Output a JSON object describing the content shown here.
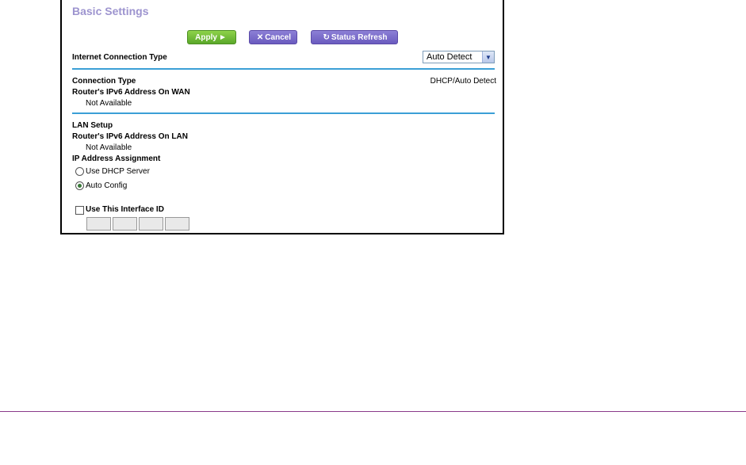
{
  "title": "Basic Settings",
  "toolbar": {
    "apply_label": "Apply",
    "cancel_label": "Cancel",
    "refresh_label": "Status Refresh"
  },
  "internet_connection": {
    "label": "Internet Connection Type",
    "selected": "Auto Detect"
  },
  "wan": {
    "connection_type_label": "Connection Type",
    "connection_type_value": "DHCP/Auto Detect",
    "ipv6_label": "Router's IPv6 Address On WAN",
    "ipv6_value": "Not Available"
  },
  "lan": {
    "section_label": "LAN Setup",
    "ipv6_label": "Router's IPv6 Address On LAN",
    "ipv6_value": "Not Available",
    "assignment_label": "IP Address Assignment",
    "options": [
      {
        "label": "Use DHCP Server",
        "selected": false
      },
      {
        "label": "Auto Config",
        "selected": true
      }
    ]
  },
  "interface_id": {
    "label": "Use This Interface ID",
    "checked": false,
    "values": [
      "",
      "",
      "",
      ""
    ]
  },
  "colors": {
    "title": "#9d94cf",
    "apply": "#6fbc35",
    "purple_button": "#7a6cc9",
    "divider": "#3b9fd6"
  }
}
